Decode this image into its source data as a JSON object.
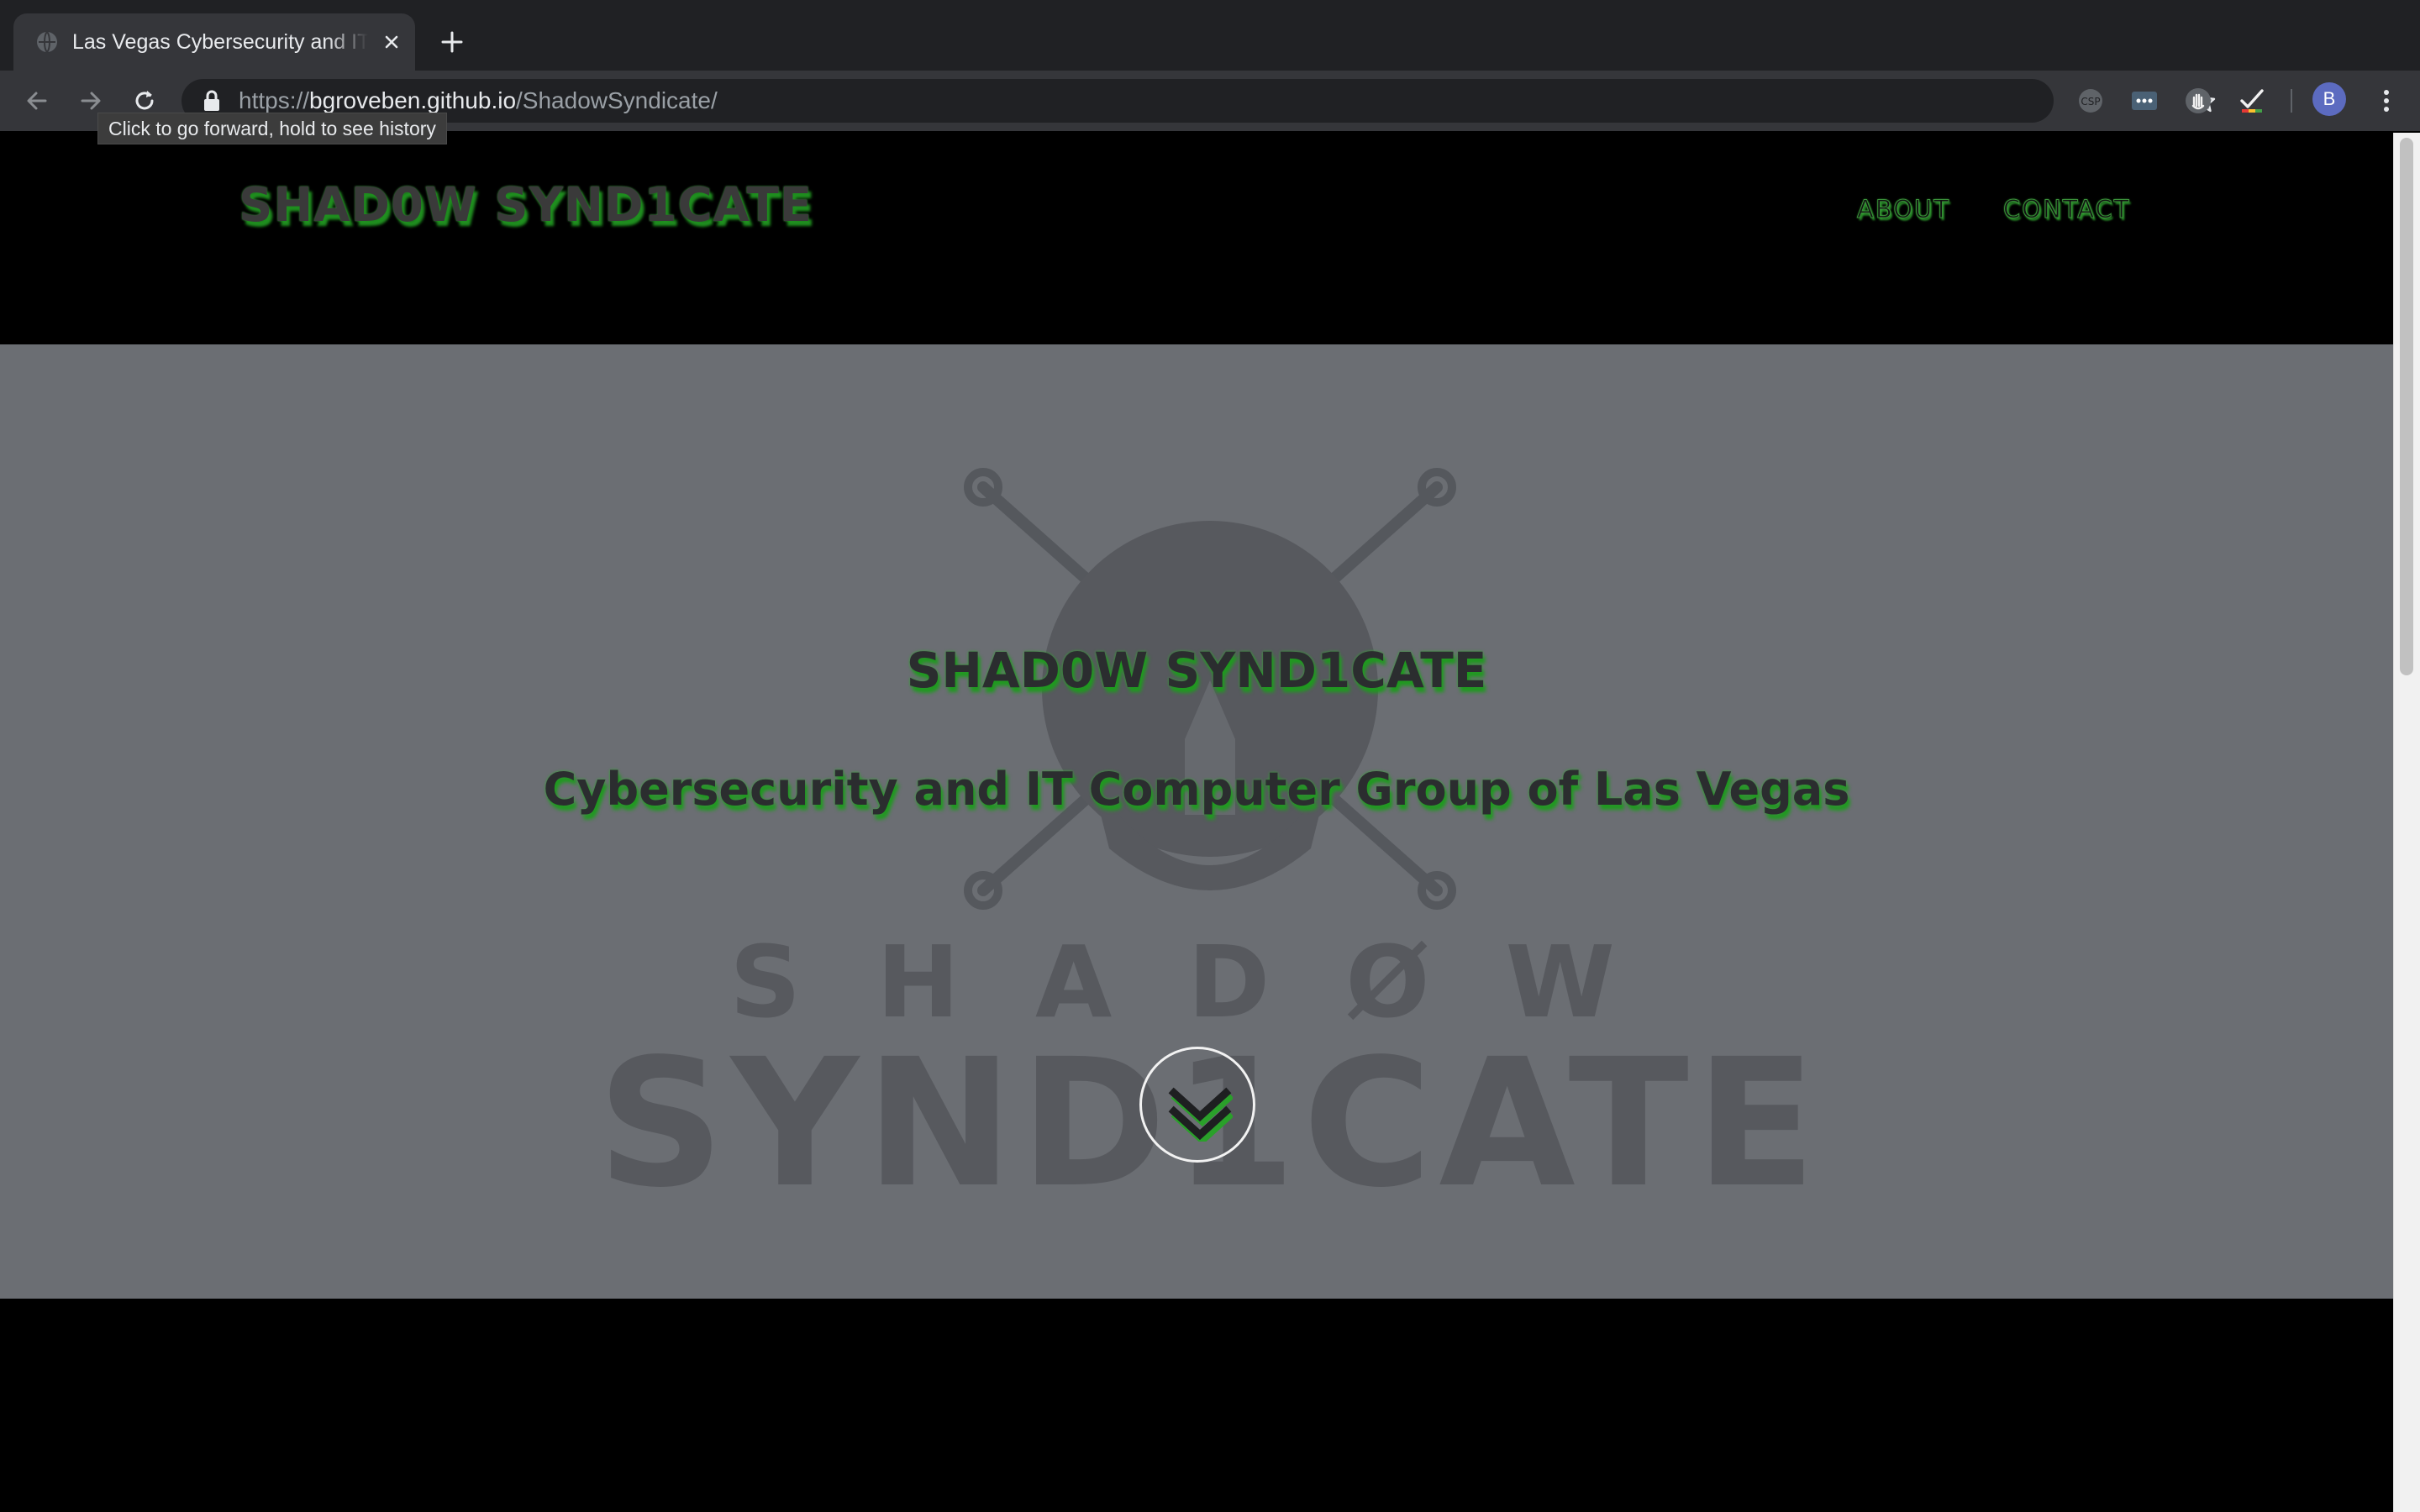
{
  "browser": {
    "tab": {
      "title": "Las Vegas Cybersecurity and IT Computer Group"
    },
    "address_bar": {
      "scheme": "https://",
      "host": "bgroveben.github.io",
      "path": "/ShadowSyndicate/"
    },
    "profile_initial": "B",
    "tooltip": "Click to go forward, hold to see history"
  },
  "site": {
    "brand": "SHAD0W SYND1CATE",
    "nav": [
      {
        "label": "ABOUT"
      },
      {
        "label": "CONTACT"
      }
    ]
  },
  "hero": {
    "title": "SHAD0W SYND1CATE",
    "subtitle": "Cybersecurity and IT Computer Group of Las Vegas",
    "logo_word_top": "SHADØW",
    "logo_word_bottom": "SYND1CATE"
  },
  "colors": {
    "accent_green": "#2e9c2e",
    "hero_background": "#6b6e73",
    "page_background": "#000000"
  }
}
